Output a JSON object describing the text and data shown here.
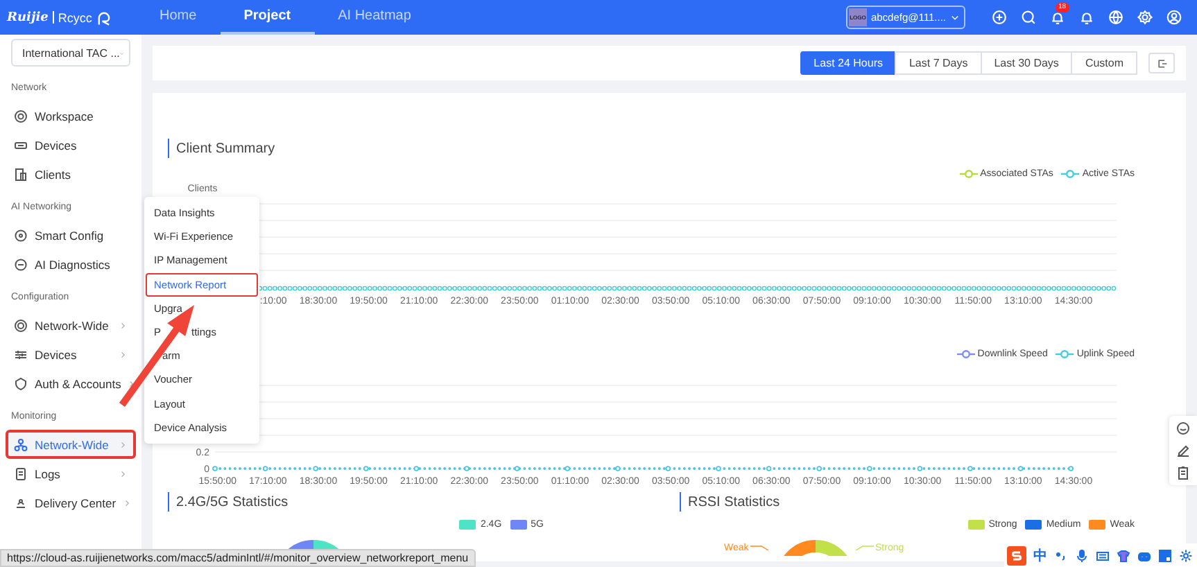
{
  "header": {
    "brand": "Ruijie",
    "product": "Rcycc",
    "tabs": [
      {
        "label": "Home",
        "selected": false
      },
      {
        "label": "Project",
        "selected": true
      },
      {
        "label": "AI Heatmap",
        "selected": false
      }
    ],
    "account": {
      "logo": "LOGO",
      "name": "abcdefg@111...."
    },
    "notification_badge": "18"
  },
  "sidebar": {
    "project_select": "International TAC ...",
    "sections": [
      {
        "title": "Network",
        "items": [
          {
            "label": "Workspace",
            "expandable": false,
            "selected": false,
            "annotated": false
          },
          {
            "label": "Devices",
            "expandable": false,
            "selected": false,
            "annotated": false
          },
          {
            "label": "Clients",
            "expandable": false,
            "selected": false,
            "annotated": false
          }
        ]
      },
      {
        "title": "AI Networking",
        "items": [
          {
            "label": "Smart Config",
            "expandable": false,
            "selected": false,
            "annotated": false
          },
          {
            "label": "AI Diagnostics",
            "expandable": false,
            "selected": false,
            "annotated": false
          }
        ]
      },
      {
        "title": "Configuration",
        "items": [
          {
            "label": "Network-Wide",
            "expandable": true,
            "selected": false,
            "annotated": false
          },
          {
            "label": "Devices",
            "expandable": true,
            "selected": false,
            "annotated": false
          },
          {
            "label": "Auth & Accounts",
            "expandable": true,
            "selected": false,
            "annotated": false
          }
        ]
      },
      {
        "title": "Monitoring",
        "items": [
          {
            "label": "Network-Wide",
            "expandable": true,
            "selected": true,
            "annotated": true
          },
          {
            "label": "Logs",
            "expandable": true,
            "selected": false,
            "annotated": false
          },
          {
            "label": "Delivery Center",
            "expandable": true,
            "selected": false,
            "annotated": false
          }
        ]
      }
    ]
  },
  "time_range": {
    "options": [
      {
        "label": "Last 24 Hours",
        "selected": true
      },
      {
        "label": "Last 7 Days",
        "selected": false
      },
      {
        "label": "Last 30 Days",
        "selected": false
      },
      {
        "label": "Custom",
        "selected": false
      }
    ]
  },
  "client_summary": {
    "title": "Client Summary",
    "ylabel": "Clients",
    "legend": [
      {
        "name": "Associated STAs",
        "color": "#b5dd3a"
      },
      {
        "name": "Active STAs",
        "color": "#3fcde3"
      }
    ],
    "x_labels": [
      ":10:00",
      "18:30:00",
      "19:50:00",
      "21:10:00",
      "22:30:00",
      "23:50:00",
      "01:10:00",
      "02:30:00",
      "03:50:00",
      "05:10:00",
      "06:30:00",
      "07:50:00",
      "09:10:00",
      "10:30:00",
      "11:50:00",
      "13:10:00",
      "14:30:00"
    ]
  },
  "speed_chart": {
    "chart_data": {
      "type": "line",
      "categories": [
        "15:50:00",
        "17:10:00",
        "18:30:00",
        "19:50:00",
        "21:10:00",
        "22:30:00",
        "23:50:00",
        "01:10:00",
        "02:30:00",
        "03:50:00",
        "05:10:00",
        "06:30:00",
        "07:50:00",
        "09:10:00",
        "10:30:00",
        "11:50:00",
        "13:10:00",
        "14:30:00"
      ],
      "series": [
        {
          "name": "Downlink Speed",
          "color": "#7c8cf8",
          "marker": "circle",
          "line_style": "dotted",
          "values": [
            0,
            0,
            0,
            0,
            0,
            0,
            0,
            0,
            0,
            0,
            0,
            0,
            0,
            0,
            0,
            0,
            0,
            0
          ]
        },
        {
          "name": "Uplink Speed",
          "color": "#3fcde3",
          "marker": "circle",
          "line_style": "dotted",
          "values": [
            0,
            0,
            0,
            0,
            0,
            0,
            0,
            0,
            0,
            0,
            0,
            0,
            0,
            0,
            0,
            0,
            0,
            0
          ]
        }
      ],
      "ylim": [
        0,
        1
      ],
      "yticks": [
        0,
        0.2
      ],
      "legend": "upper right"
    }
  },
  "statistics": [
    {
      "title": "2.4G/5G Statistics",
      "legend": [
        {
          "label": "2.4G",
          "color": "#4fe3c6"
        },
        {
          "label": "5G",
          "color": "#6f86f5"
        }
      ]
    },
    {
      "title": "RSSI Statistics",
      "legend": [
        {
          "label": "Strong",
          "color": "#c2e04a"
        },
        {
          "label": "Medium",
          "color": "#1a6fe6"
        },
        {
          "label": "Weak",
          "color": "#ff8a1f"
        }
      ],
      "donut_labels": [
        {
          "label": "Weak",
          "color": "#ff8a1f"
        },
        {
          "label": "Strong",
          "color": "#c2e04a"
        }
      ]
    }
  ],
  "submenu": {
    "items": [
      {
        "kind": "plain",
        "label": "Data Insights",
        "selected": false,
        "annotated": false
      },
      {
        "kind": "plain",
        "label": "Wi-Fi Experience",
        "selected": false,
        "annotated": false
      },
      {
        "kind": "plain",
        "label": "IP Management",
        "selected": false,
        "annotated": false
      },
      {
        "kind": "plain",
        "label": "Network Report",
        "selected": true,
        "annotated": true
      },
      {
        "kind": "plain",
        "label": "Upgra",
        "selected": false,
        "annotated": false
      },
      {
        "kind": "split",
        "parts": [
          "P",
          "ttings"
        ],
        "selected": false,
        "annotated": false
      },
      {
        "kind": "covered_start",
        "label": "arm",
        "selected": false,
        "annotated": false
      },
      {
        "kind": "plain",
        "label": "Voucher",
        "selected": false,
        "annotated": false
      },
      {
        "kind": "plain",
        "label": "Layout",
        "selected": false,
        "annotated": false
      },
      {
        "kind": "plain",
        "label": "Device Analysis",
        "selected": false,
        "annotated": false
      }
    ]
  },
  "status_bar": {
    "url": "https://cloud-as.ruijienetworks.com/macc5/adminIntl/#/monitor_overview_networkreport_menu"
  },
  "ime_bar": {
    "mode": "中"
  }
}
